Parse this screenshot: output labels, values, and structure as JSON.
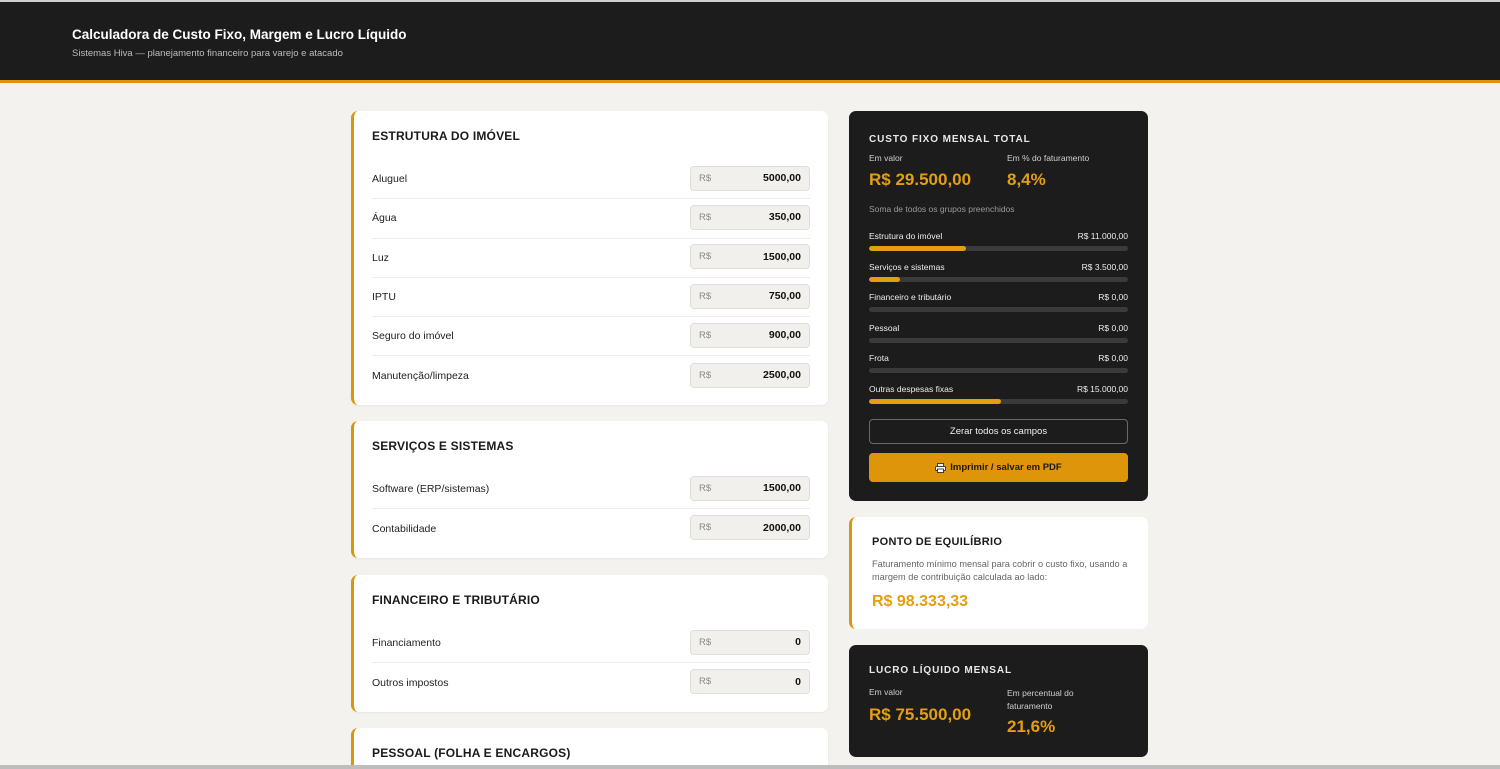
{
  "header": {
    "title": "Calculadora de Custo Fixo, Margem e Lucro Líquido",
    "subtitle": "Sistemas Hiva — planejamento financeiro para varejo e atacado"
  },
  "currency_prefix": "R$",
  "sections": [
    {
      "title": "ESTRUTURA DO IMÓVEL",
      "rows": [
        {
          "label": "Aluguel",
          "value": "5000,00"
        },
        {
          "label": "Água",
          "value": "350,00"
        },
        {
          "label": "Luz",
          "value": "1500,00"
        },
        {
          "label": "IPTU",
          "value": "750,00"
        },
        {
          "label": "Seguro do imóvel",
          "value": "900,00"
        },
        {
          "label": "Manutenção/limpeza",
          "value": "2500,00"
        }
      ]
    },
    {
      "title": "SERVIÇOS E SISTEMAS",
      "rows": [
        {
          "label": "Software (ERP/sistemas)",
          "value": "1500,00"
        },
        {
          "label": "Contabilidade",
          "value": "2000,00"
        }
      ]
    },
    {
      "title": "FINANCEIRO E TRIBUTÁRIO",
      "rows": [
        {
          "label": "Financiamento",
          "value": "0"
        },
        {
          "label": "Outros impostos",
          "value": "0"
        }
      ]
    },
    {
      "title": "PESSOAL (FOLHA E ENCARGOS)",
      "rows": []
    }
  ],
  "fixed_cost": {
    "title": "CUSTO FIXO MENSAL TOTAL",
    "value_label": "Em valor",
    "value": "R$ 29.500,00",
    "pct_label": "Em % do faturamento",
    "pct": "8,4%",
    "note": "Soma de todos os grupos preenchidos",
    "groups": [
      {
        "label": "Estrutura do imóvel",
        "amount": "R$ 11.000,00",
        "share": 0.3729
      },
      {
        "label": "Serviços e sistemas",
        "amount": "R$ 3.500,00",
        "share": 0.1186
      },
      {
        "label": "Financeiro e tributário",
        "amount": "R$ 0,00",
        "share": 0
      },
      {
        "label": "Pessoal",
        "amount": "R$ 0,00",
        "share": 0
      },
      {
        "label": "Frota",
        "amount": "R$ 0,00",
        "share": 0
      },
      {
        "label": "Outras despesas fixas",
        "amount": "R$ 15.000,00",
        "share": 0.5085
      }
    ],
    "reset_label": "Zerar todos os campos",
    "print_label": "Imprimir / salvar em PDF"
  },
  "breakeven": {
    "title": "PONTO DE EQUILÍBRIO",
    "description": "Faturamento mínimo mensal para cobrir o custo fixo, usando a margem de contribuição calculada ao lado:",
    "value": "R$ 98.333,33"
  },
  "net_profit": {
    "title": "LUCRO LÍQUIDO MENSAL",
    "value_label": "Em valor",
    "value": "R$ 75.500,00",
    "pct_label": "Em percentual do faturamento",
    "pct": "21,6%"
  },
  "colors": {
    "accent": "#d9960a",
    "dark": "#1c1c1c",
    "background": "#f3f2ef"
  }
}
